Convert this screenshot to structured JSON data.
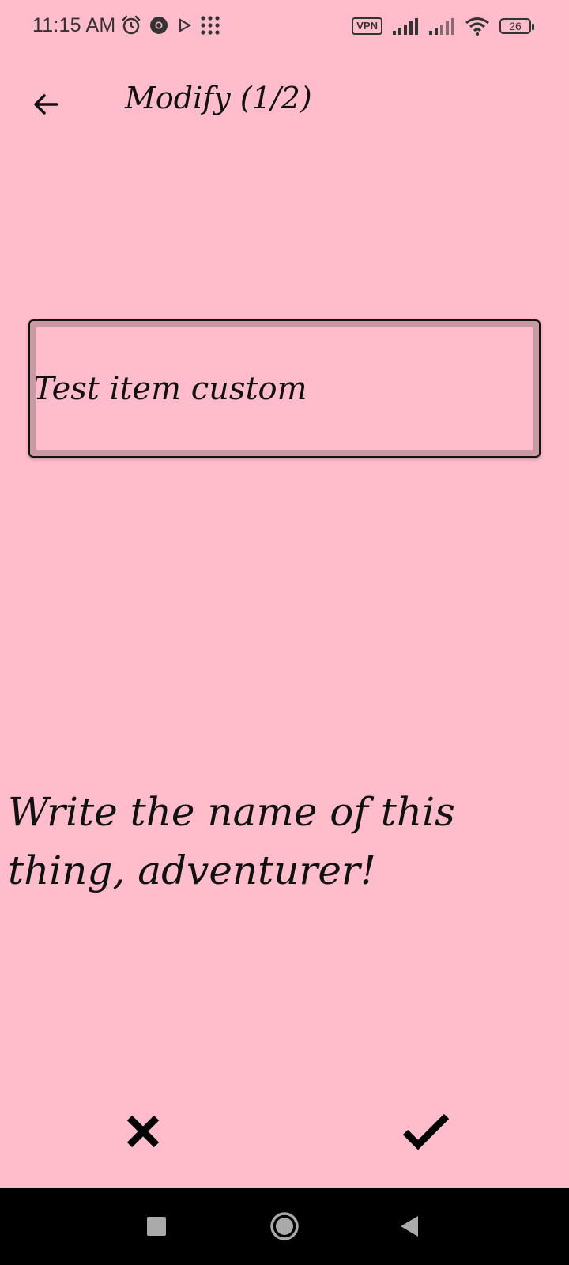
{
  "status_bar": {
    "time": "11:15 AM",
    "vpn_label": "VPN",
    "battery_level": "26",
    "icons_left": [
      "alarm-icon",
      "chrome-icon",
      "play-icon",
      "dots-grid-icon"
    ],
    "icons_right": [
      "vpn-icon",
      "signal-icon",
      "signal-icon",
      "wifi-icon",
      "battery-icon"
    ]
  },
  "app_bar": {
    "title": "Modify (1/2)",
    "back_icon": "arrow-left-icon"
  },
  "form": {
    "name_value": "Test item custom"
  },
  "prompt": {
    "text": "Write the name of this thing, adventurer!"
  },
  "actions": {
    "cancel_icon": "close-icon",
    "confirm_icon": "check-icon"
  },
  "nav_bar": {
    "icons": [
      "recent-apps-icon",
      "home-icon",
      "back-triangle-icon"
    ]
  },
  "colors": {
    "background": "#ffbccb",
    "text": "#111111",
    "nav_bar": "#000000",
    "input_border": "#c99aa4"
  }
}
